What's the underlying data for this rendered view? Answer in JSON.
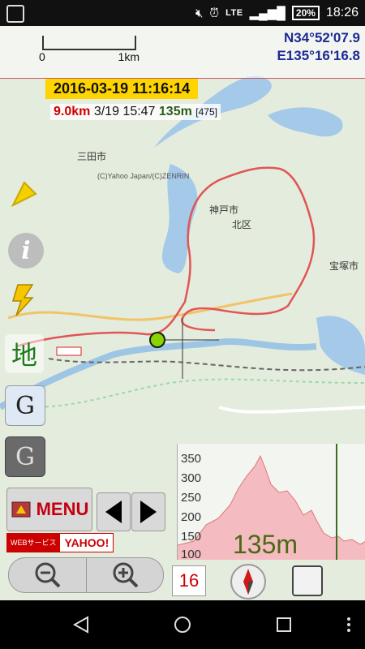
{
  "status": {
    "network": "LTE",
    "battery": "20%",
    "time": "18:26"
  },
  "map": {
    "coords": {
      "lat": "N34°52'07.9",
      "lon": "E135°16'16.8"
    },
    "scale": {
      "left": "0",
      "right": "1km"
    },
    "place_labels": [
      "三田市",
      "神戸市",
      "北区",
      "宝塚市"
    ],
    "attribution": "(C)Yahoo Japan/(C)ZENRIN"
  },
  "info": {
    "datetime": "2016-03-19 11:16:14",
    "distance": "9.0km",
    "date_time_short": "3/19 15:47",
    "altitude": "135m",
    "count": "[475]"
  },
  "left_buttons": {
    "info_icon": "i",
    "map_label": "地",
    "g1": "G",
    "g2": "G"
  },
  "menu": {
    "label": "MENU"
  },
  "yahoo_badge": {
    "web_service": "WEBサービス",
    "brand": "YAHOO!"
  },
  "profile": {
    "y_ticks": [
      "350",
      "300",
      "250",
      "200",
      "150",
      "100"
    ],
    "current_alt": "135m"
  },
  "controls": {
    "zoom_level": "16"
  }
}
